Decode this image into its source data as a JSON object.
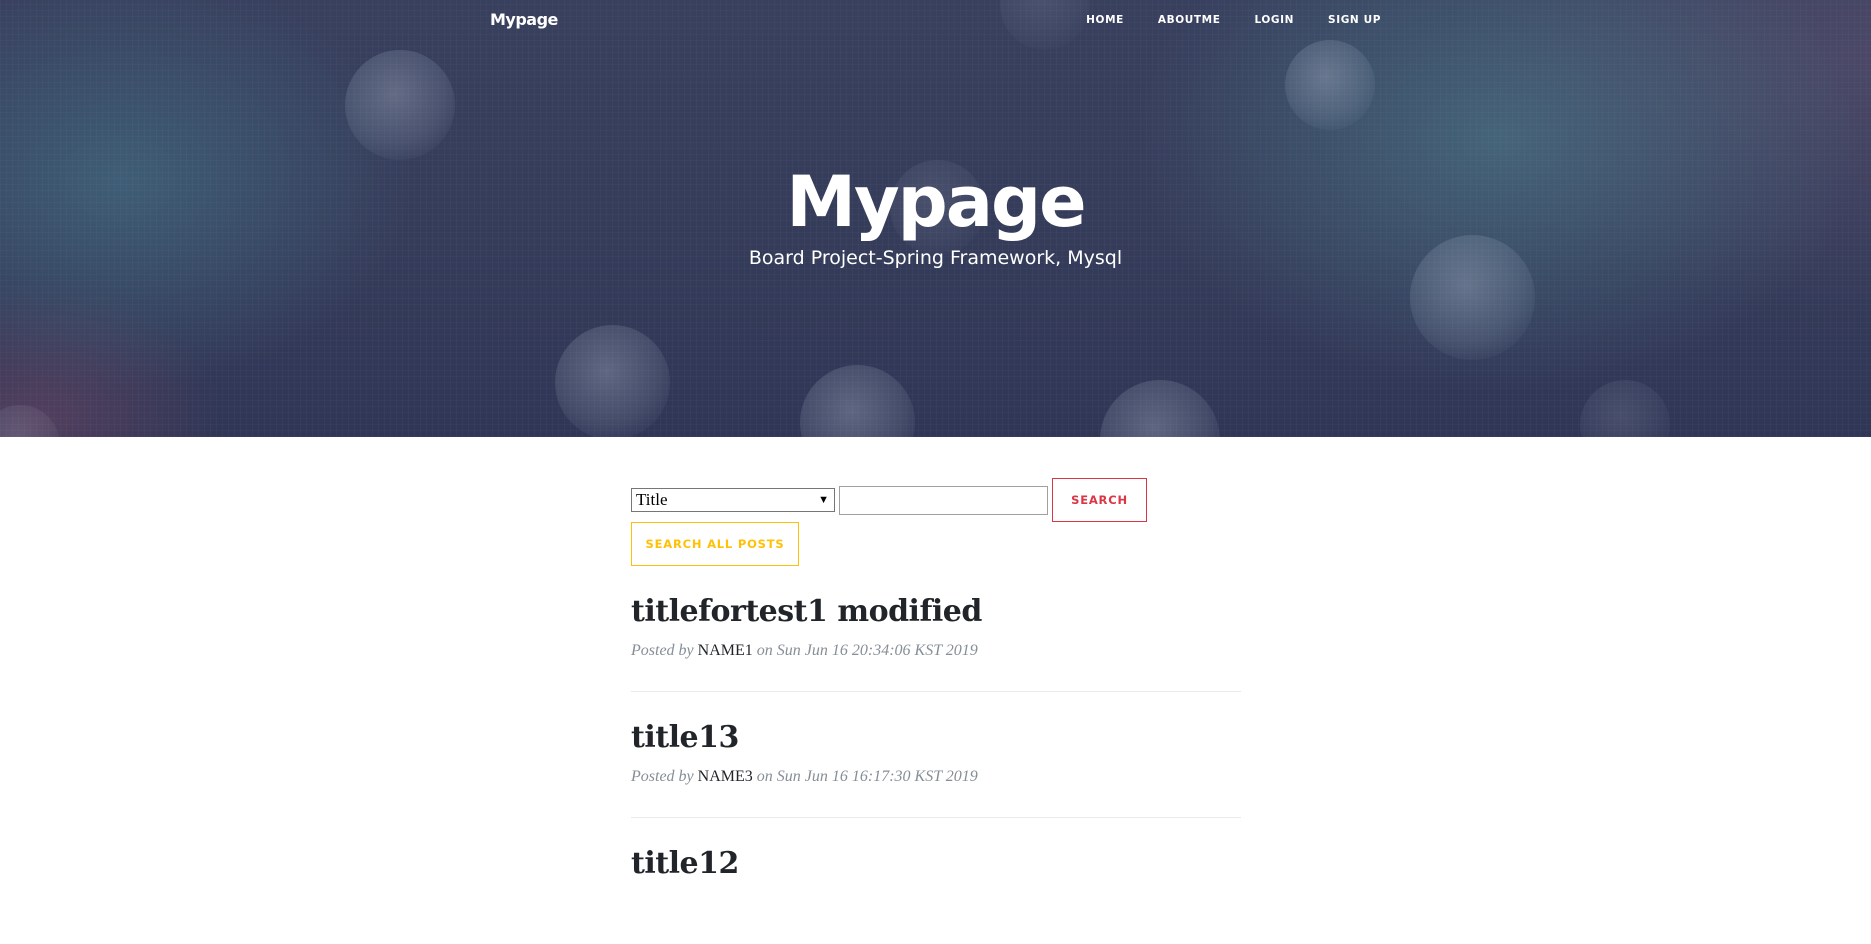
{
  "nav": {
    "brand": "Mypage",
    "items": [
      {
        "label": "HOME"
      },
      {
        "label": "ABOUTME"
      },
      {
        "label": "LOGIN"
      },
      {
        "label": "SIGN UP"
      }
    ]
  },
  "hero": {
    "title": "Mypage",
    "subtitle": "Board Project-Spring Framework, Mysql"
  },
  "search": {
    "select_value": "Title",
    "input_value": "",
    "search_label": "SEARCH",
    "all_posts_label": "SEARCH ALL POSTS"
  },
  "posts": [
    {
      "title": "titlefortest1 modified",
      "posted_by": "Posted by",
      "author": "NAME1",
      "on": "on",
      "date": "Sun Jun 16 20:34:06 KST 2019"
    },
    {
      "title": "title13",
      "posted_by": "Posted by",
      "author": "NAME3",
      "on": "on",
      "date": "Sun Jun 16 16:17:30 KST 2019"
    },
    {
      "title": "title12",
      "posted_by": "",
      "author": "",
      "on": "",
      "date": ""
    }
  ],
  "colors": {
    "search_button": "#dc3545",
    "all_posts_button": "#ffc107",
    "text": "#212529",
    "meta": "#868e96"
  }
}
